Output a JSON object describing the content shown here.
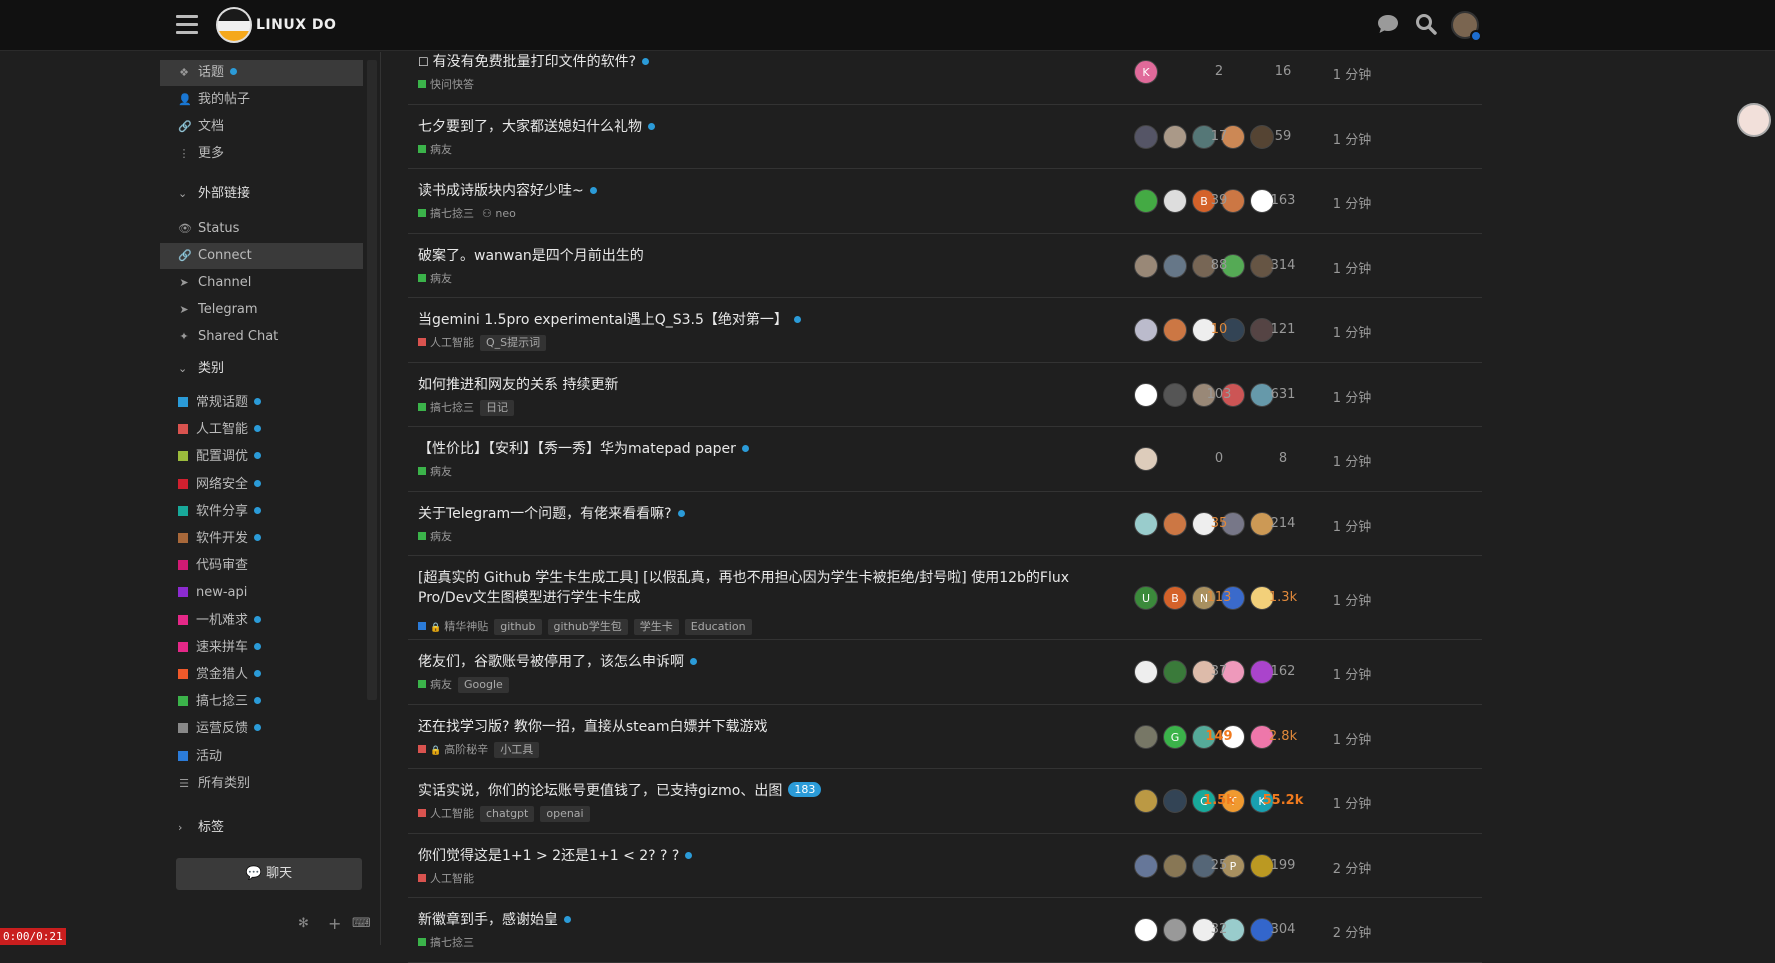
{
  "header": {
    "site_title": "LINUX DO"
  },
  "sidebar": {
    "nav": [
      {
        "label": "话题",
        "icon": "layers-icon",
        "dot": true,
        "active": true
      },
      {
        "label": "我的帖子",
        "icon": "user-icon"
      },
      {
        "label": "文档",
        "icon": "link-icon"
      },
      {
        "label": "更多",
        "icon": "more-icon"
      }
    ],
    "ext_title": "外部链接",
    "ext": [
      {
        "label": "Status",
        "icon": "eye-icon"
      },
      {
        "label": "Connect",
        "icon": "link-icon",
        "hover": true
      },
      {
        "label": "Channel",
        "icon": "send-icon"
      },
      {
        "label": "Telegram",
        "icon": "send-icon"
      },
      {
        "label": "Shared Chat",
        "icon": "sparkle-icon"
      }
    ],
    "cat_title": "类别",
    "categories": [
      {
        "label": "常规话题",
        "color": "#2b9bd8",
        "dot": true
      },
      {
        "label": "人工智能",
        "color": "#d9534f",
        "dot": true
      },
      {
        "label": "配置调优",
        "color": "#9bbb3c",
        "dot": true
      },
      {
        "label": "网络安全",
        "color": "#d0202f",
        "dot": true
      },
      {
        "label": "软件分享",
        "color": "#18a99a",
        "dot": true
      },
      {
        "label": "软件开发",
        "color": "#a8683a",
        "dot": true
      },
      {
        "label": "代码审查",
        "color": "#d11a74",
        "dot": false
      },
      {
        "label": "new-api",
        "color": "#8c2bd0",
        "dot": false
      },
      {
        "label": "一机难求",
        "color": "#e52888",
        "dot": true
      },
      {
        "label": "速来拼车",
        "color": "#e52888",
        "dot": true
      },
      {
        "label": "赏金猎人",
        "color": "#f0592a",
        "dot": true
      },
      {
        "label": "搞七捻三",
        "color": "#3bb34a",
        "dot": true
      },
      {
        "label": "运营反馈",
        "color": "#888888",
        "dot": true
      },
      {
        "label": "活动",
        "color": "#2b7bd8",
        "dot": false
      },
      {
        "label": "所有类别",
        "color": "",
        "dot": false,
        "list": true
      }
    ],
    "tags_title": "标签",
    "chat_label": "聊天"
  },
  "timer": "0:00/0:21",
  "topics": [
    {
      "title": "有没有免费批量打印文件的软件?",
      "dot": true,
      "check": true,
      "category": "快问快答",
      "cat_color": "#3bb34a",
      "tags": [],
      "replies": "2",
      "views": "16",
      "activity": "1 分钟",
      "avatars": [
        {
          "t": "K",
          "c": "#e06a9a"
        }
      ]
    },
    {
      "title": "七夕要到了，大家都送媳妇什么礼物",
      "dot": true,
      "category": "病友",
      "cat_color": "#3bb34a",
      "tags": [],
      "replies": "17",
      "views": "59",
      "activity": "1 分钟",
      "avatars": [
        {
          "t": "",
          "c": "#556"
        },
        {
          "t": "",
          "c": "#a98"
        },
        {
          "t": "",
          "c": "#577"
        },
        {
          "t": "",
          "c": "#c85"
        },
        {
          "t": "",
          "c": "#543"
        }
      ]
    },
    {
      "title": "读书成诗版块内容好少哇~",
      "dot": true,
      "category": "搞七捻三",
      "cat_color": "#3bb34a",
      "extra": "neo",
      "tags": [],
      "replies": "39",
      "views": "163",
      "activity": "1 分钟",
      "avatars": [
        {
          "t": "",
          "c": "#4a4"
        },
        {
          "t": "",
          "c": "#ddd"
        },
        {
          "t": "B",
          "c": "#d4622a"
        },
        {
          "t": "",
          "c": "#c74"
        },
        {
          "t": "",
          "c": "#fff"
        }
      ]
    },
    {
      "title": "破案了。wanwan是四个月前出生的",
      "dot": false,
      "category": "病友",
      "cat_color": "#3bb34a",
      "tags": [],
      "replies": "88",
      "views": "314",
      "activity": "1 分钟",
      "avatars": [
        {
          "t": "",
          "c": "#987"
        },
        {
          "t": "",
          "c": "#678"
        },
        {
          "t": "",
          "c": "#765"
        },
        {
          "t": "",
          "c": "#5a5"
        },
        {
          "t": "",
          "c": "#654"
        }
      ]
    },
    {
      "title": "当gemini 1.5pro experimental遇上Q_S3.5【绝对第一】",
      "dot": true,
      "category": "人工智能",
      "cat_color": "#d9534f",
      "tags": [
        "Q_S提示词"
      ],
      "replies": "10",
      "replies_hot": true,
      "views": "121",
      "activity": "1 分钟",
      "avatars": [
        {
          "t": "",
          "c": "#bbc"
        },
        {
          "t": "",
          "c": "#c74"
        },
        {
          "t": "",
          "c": "#eee"
        },
        {
          "t": "",
          "c": "#345"
        },
        {
          "t": "",
          "c": "#544"
        }
      ]
    },
    {
      "title": "如何推进和网友的关系 持续更新",
      "dot": false,
      "category": "搞七捻三",
      "cat_color": "#3bb34a",
      "tags": [
        "日记"
      ],
      "replies": "103",
      "views": "631",
      "activity": "1 分钟",
      "avatars": [
        {
          "t": "",
          "c": "#fff"
        },
        {
          "t": "",
          "c": "#555"
        },
        {
          "t": "",
          "c": "#987"
        },
        {
          "t": "",
          "c": "#c55"
        },
        {
          "t": "",
          "c": "#69a"
        }
      ]
    },
    {
      "title": "【性价比】【安利】【秀一秀】华为matepad paper",
      "dot": true,
      "category": "病友",
      "cat_color": "#3bb34a",
      "tags": [],
      "replies": "0",
      "views": "8",
      "activity": "1 分钟",
      "avatars": [
        {
          "t": "",
          "c": "#dcb"
        }
      ]
    },
    {
      "title": "关于Telegram一个问题，有佬来看看嘛?",
      "dot": true,
      "category": "病友",
      "cat_color": "#3bb34a",
      "tags": [],
      "replies": "35",
      "replies_hot": true,
      "views": "214",
      "activity": "1 分钟",
      "avatars": [
        {
          "t": "",
          "c": "#9cc"
        },
        {
          "t": "",
          "c": "#c74"
        },
        {
          "t": "",
          "c": "#eee"
        },
        {
          "t": "",
          "c": "#778"
        },
        {
          "t": "",
          "c": "#c95"
        }
      ]
    },
    {
      "title": "[超真实的 Github 学生卡生成工具] [以假乱真，再也不用担心因为学生卡被拒绝/封号啦] 使用12b的Flux Pro/Dev文生图模型进行学生卡生成",
      "dot": false,
      "two_line": true,
      "locked": true,
      "category": "精华神贴",
      "cat_color": "#2b7bd8",
      "tags": [
        "github",
        "github学生包",
        "学生卡",
        "Education"
      ],
      "replies": "113",
      "replies_hot": true,
      "views": "1.3k",
      "views_hot": true,
      "activity": "1 分钟",
      "avatars": [
        {
          "t": "U",
          "c": "#3b8a3b"
        },
        {
          "t": "B",
          "c": "#d4622a"
        },
        {
          "t": "N",
          "c": "#a89060"
        },
        {
          "t": "",
          "c": "#3a6acb"
        },
        {
          "t": "",
          "c": "#f2d07a"
        }
      ]
    },
    {
      "title": "佬友们，谷歌账号被停用了，该怎么申诉啊",
      "dot": true,
      "category": "病友",
      "cat_color": "#3bb34a",
      "tags": [
        "Google"
      ],
      "replies": "37",
      "views": "162",
      "activity": "1 分钟",
      "avatars": [
        {
          "t": "",
          "c": "#eee"
        },
        {
          "t": "",
          "c": "#3a7a3a"
        },
        {
          "t": "",
          "c": "#dba"
        },
        {
          "t": "",
          "c": "#e9b"
        },
        {
          "t": "",
          "c": "#a4c"
        }
      ]
    },
    {
      "title": "还在找学习版? 教你一招，直接从steam白嫖并下载游戏",
      "dot": false,
      "locked": true,
      "category": "高阶秘辛",
      "cat_color": "#d9534f",
      "tags": [
        "小工具"
      ],
      "replies": "149",
      "replies_hot2": true,
      "views": "2.8k",
      "views_hot": true,
      "activity": "1 分钟",
      "avatars": [
        {
          "t": "",
          "c": "#776"
        },
        {
          "t": "G",
          "c": "#3bb34a"
        },
        {
          "t": "",
          "c": "#5a9"
        },
        {
          "t": "",
          "c": "#fff"
        },
        {
          "t": "",
          "c": "#e7a"
        }
      ]
    },
    {
      "title": "实话实说，你们的论坛账号更值钱了，已支持gizmo、出图",
      "badge": "183",
      "category": "人工智能",
      "cat_color": "#d9534f",
      "tags": [
        "chatgpt",
        "openai"
      ],
      "replies": "1.5k",
      "replies_hot2": true,
      "views": "55.2k",
      "views_hot2": true,
      "activity": "1 分钟",
      "avatars": [
        {
          "t": "",
          "c": "#b94"
        },
        {
          "t": "",
          "c": "#345"
        },
        {
          "t": "C",
          "c": "#18a99a"
        },
        {
          "t": "T",
          "c": "#f09a30"
        },
        {
          "t": "K",
          "c": "#18a0b0"
        }
      ]
    },
    {
      "title": "你们觉得这是1+1 > 2还是1+1 < 2? ? ?",
      "dot": true,
      "category": "人工智能",
      "cat_color": "#d9534f",
      "tags": [],
      "replies": "25",
      "views": "199",
      "activity": "2 分钟",
      "avatars": [
        {
          "t": "",
          "c": "#679"
        },
        {
          "t": "",
          "c": "#875"
        },
        {
          "t": "",
          "c": "#567"
        },
        {
          "t": "P",
          "c": "#a89060"
        },
        {
          "t": "",
          "c": "#b92"
        }
      ]
    },
    {
      "title": "新徽章到手，感谢始皇",
      "dot": true,
      "category": "搞七捻三",
      "cat_color": "#3bb34a",
      "tags": [],
      "replies": "32",
      "views": "304",
      "activity": "2 分钟",
      "avatars": [
        {
          "t": "",
          "c": "#fff"
        },
        {
          "t": "",
          "c": "#999"
        },
        {
          "t": "",
          "c": "#eee"
        },
        {
          "t": "",
          "c": "#9cc"
        },
        {
          "t": "",
          "c": "#36c"
        }
      ]
    }
  ]
}
